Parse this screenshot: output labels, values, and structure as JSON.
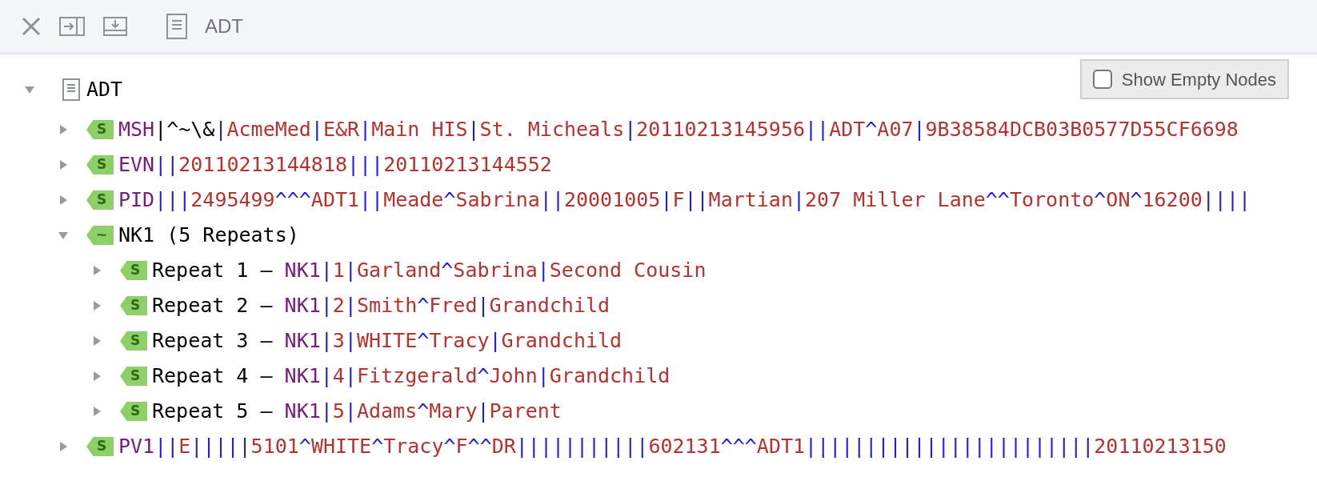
{
  "toolbar": {
    "title": "ADT"
  },
  "show_empty_nodes": {
    "label": "Show Empty Nodes",
    "checked": false
  },
  "tree": {
    "label": "ADT",
    "expanded": true,
    "children": [
      {
        "kind": "segment",
        "badge": "S",
        "name": "MSH",
        "encoding": "|^~\\&",
        "fields": "|AcmeMed|E&R|Main HIS|St. Micheals|20110213145956||ADT^A07|9B38584DCB03B0577D55CF6698",
        "expanded": false
      },
      {
        "kind": "segment",
        "badge": "S",
        "name": "EVN",
        "fields": "||20110213144818|||20110213144552",
        "expanded": false
      },
      {
        "kind": "segment",
        "badge": "S",
        "name": "PID",
        "fields": "|||2495499^^^ADT1||Meade^Sabrina||20001005|F||Martian|207 Miller Lane^^Toronto^ON^16200||||",
        "expanded": false
      },
      {
        "kind": "group",
        "badge": "~",
        "label": "NK1 (5 Repeats)",
        "expanded": true,
        "children": [
          {
            "kind": "segment",
            "badge": "S",
            "prefix": "Repeat 1 – ",
            "name": "NK1",
            "fields": "|1|Garland^Sabrina|Second Cousin",
            "expanded": false
          },
          {
            "kind": "segment",
            "badge": "S",
            "prefix": "Repeat 2 – ",
            "name": "NK1",
            "fields": "|2|Smith^Fred|Grandchild",
            "expanded": false
          },
          {
            "kind": "segment",
            "badge": "S",
            "prefix": "Repeat 3 – ",
            "name": "NK1",
            "fields": "|3|WHITE^Tracy|Grandchild",
            "expanded": false
          },
          {
            "kind": "segment",
            "badge": "S",
            "prefix": "Repeat 4 – ",
            "name": "NK1",
            "fields": "|4|Fitzgerald^John|Grandchild",
            "expanded": false
          },
          {
            "kind": "segment",
            "badge": "S",
            "prefix": "Repeat 5 – ",
            "name": "NK1",
            "fields": "|5|Adams^Mary|Parent",
            "expanded": false
          }
        ]
      },
      {
        "kind": "segment",
        "badge": "S",
        "name": "PV1",
        "fields": "||E|||||5101^WHITE^Tracy^F^^DR|||||||||||602131^^^ADT1||||||||||||||||||||||||20110213150",
        "expanded": false
      }
    ]
  }
}
